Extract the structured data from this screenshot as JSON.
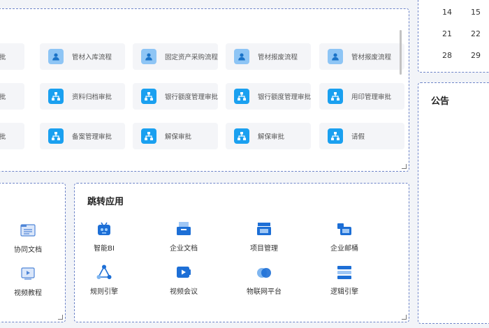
{
  "workflow": {
    "rows": [
      [
        {
          "label": "批",
          "icon": "person-icon",
          "cut": true
        },
        {
          "label": "管材入库流程",
          "icon": "person-icon"
        },
        {
          "label": "固定资产采购流程",
          "icon": "person-icon"
        },
        {
          "label": "管材报废流程",
          "icon": "person-icon"
        },
        {
          "label": "管材报废流程",
          "icon": "person-icon"
        }
      ],
      [
        {
          "label": "批",
          "icon": "org-chart-icon",
          "cut": true
        },
        {
          "label": "资料归档审批",
          "icon": "org-chart-icon"
        },
        {
          "label": "银行额度管理审批",
          "icon": "org-chart-icon"
        },
        {
          "label": "银行额度管理审批",
          "icon": "org-chart-icon"
        },
        {
          "label": "用印管理审批",
          "icon": "org-chart-icon"
        }
      ],
      [
        {
          "label": "批",
          "icon": "org-chart-icon",
          "cut": true
        },
        {
          "label": "备案管理审批",
          "icon": "org-chart-icon"
        },
        {
          "label": "解保审批",
          "icon": "org-chart-icon"
        },
        {
          "label": "解保审批",
          "icon": "org-chart-icon"
        },
        {
          "label": "请假",
          "icon": "org-chart-icon"
        }
      ]
    ]
  },
  "calendar": {
    "rows": [
      [
        "14",
        "15"
      ],
      [
        "21",
        "22"
      ],
      [
        "28",
        "29"
      ]
    ]
  },
  "notice": {
    "title": "公告"
  },
  "left_apps": [
    {
      "label": "协同文档",
      "icon": "document-folder-icon"
    },
    {
      "label": "视频教程",
      "icon": "video-tutorial-icon"
    }
  ],
  "jump": {
    "title": "跳转应用",
    "apps": [
      {
        "label": "智能BI",
        "icon": "robot-icon"
      },
      {
        "label": "企业文档",
        "icon": "file-box-icon"
      },
      {
        "label": "项目管理",
        "icon": "project-box-icon"
      },
      {
        "label": "企业邮桶",
        "icon": "mailbox-icon"
      },
      {
        "label": "规则引擎",
        "icon": "rule-network-icon"
      },
      {
        "label": "视频会议",
        "icon": "video-camera-icon"
      },
      {
        "label": "物联网平台",
        "icon": "iot-cloud-icon"
      },
      {
        "label": "逻辑引擎",
        "icon": "logic-engine-icon"
      }
    ]
  },
  "colors": {
    "primary": "#1aa0f0",
    "light_primary": "#8ec5f5",
    "panel_border": "#6d84c8"
  }
}
